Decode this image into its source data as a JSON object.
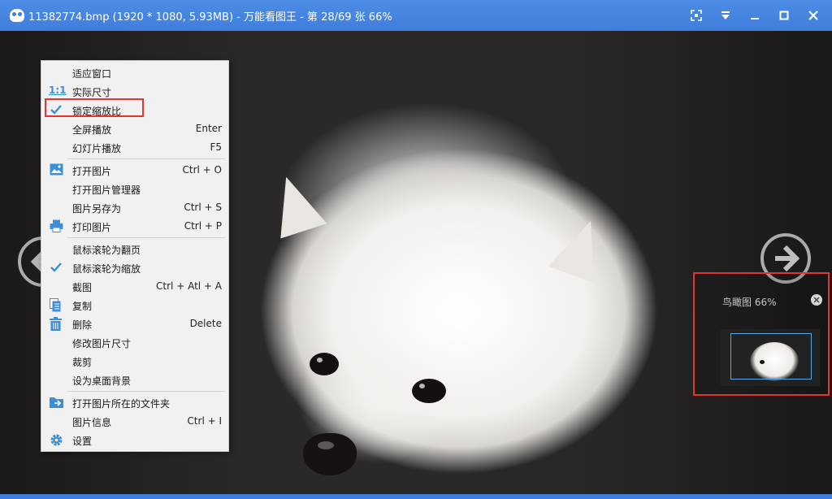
{
  "window": {
    "title": "11382774.bmp (1920 * 1080, 5.93MB) - 万能看图王 - 第 28/69 张 66%",
    "controls": [
      "fullscreen-icon",
      "dropdown-icon",
      "minimize-icon",
      "maximize-icon",
      "close-icon"
    ]
  },
  "context_menu": {
    "items": [
      {
        "label": "适应窗口",
        "shortcut": "",
        "icon": ""
      },
      {
        "label": "实际尺寸",
        "shortcut": "",
        "icon": "1:1"
      },
      {
        "label": "锁定缩放比",
        "shortcut": "",
        "icon": "check-icon",
        "checked": true
      },
      {
        "label": "全屏播放",
        "shortcut": "Enter",
        "icon": ""
      },
      {
        "label": "幻灯片播放",
        "shortcut": "F5",
        "icon": ""
      },
      {
        "label": "打开图片",
        "shortcut": "Ctrl + O",
        "icon": "image-icon"
      },
      {
        "label": "打开图片管理器",
        "shortcut": "",
        "icon": ""
      },
      {
        "label": "图片另存为",
        "shortcut": "Ctrl + S",
        "icon": ""
      },
      {
        "label": "打印图片",
        "shortcut": "Ctrl + P",
        "icon": "printer-icon"
      },
      {
        "label": "鼠标滚轮为翻页",
        "shortcut": "",
        "icon": ""
      },
      {
        "label": "鼠标滚轮为缩放",
        "shortcut": "",
        "icon": "check-icon",
        "checked": true
      },
      {
        "label": "截图",
        "shortcut": "Ctrl + Atl + A",
        "icon": ""
      },
      {
        "label": "复制",
        "shortcut": "",
        "icon": "copy-icon"
      },
      {
        "label": "删除",
        "shortcut": "Delete",
        "icon": "trash-icon"
      },
      {
        "label": "修改图片尺寸",
        "shortcut": "",
        "icon": ""
      },
      {
        "label": "裁剪",
        "shortcut": "",
        "icon": ""
      },
      {
        "label": "设为桌面背景",
        "shortcut": "",
        "icon": ""
      },
      {
        "label": "打开图片所在的文件夹",
        "shortcut": "",
        "icon": "folder-icon"
      },
      {
        "label": "图片信息",
        "shortcut": "Ctrl + I",
        "icon": ""
      },
      {
        "label": "设置",
        "shortcut": "",
        "icon": "gear-icon"
      }
    ]
  },
  "navigator": {
    "title": "鸟瞰图 66%"
  },
  "colors": {
    "titlebar": "#3f7edb",
    "accent_icon": "#3a8fd9",
    "highlight_border": "#e53232",
    "menu_bg": "#f1f1f1"
  }
}
